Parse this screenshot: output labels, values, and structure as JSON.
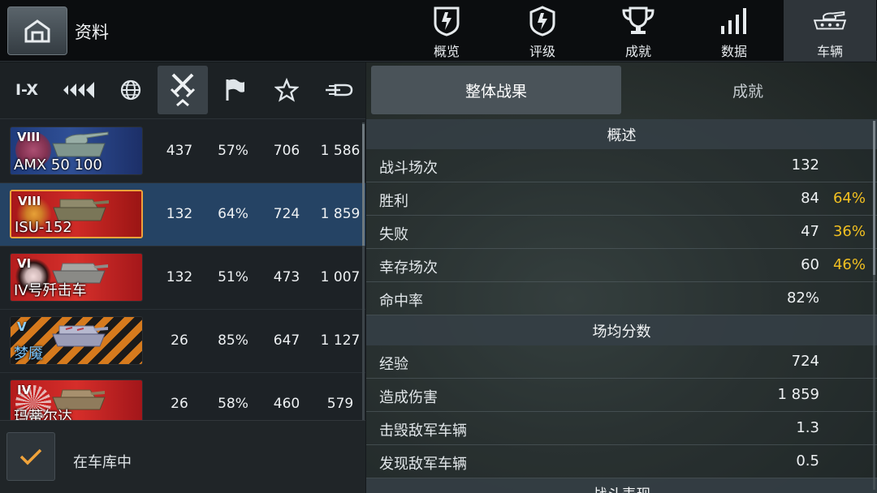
{
  "header": {
    "title": "资料",
    "tabs": [
      {
        "label": "概览",
        "icon": "shield-bolt-icon"
      },
      {
        "label": "评级",
        "icon": "rating-shield-icon"
      },
      {
        "label": "成就",
        "icon": "trophy-icon"
      },
      {
        "label": "数据",
        "icon": "bar-chart-icon"
      },
      {
        "label": "车辆",
        "icon": "tank-icon",
        "active": true
      }
    ]
  },
  "filters": {
    "tier_label": "I-X",
    "items": [
      "tier-filter",
      "vehicle-type-filter",
      "nation-filter",
      "battles-sort",
      "victories-sort",
      "favorite-filter",
      "premium-filter"
    ],
    "active": "battles-sort"
  },
  "vehicles": [
    {
      "tier": "VIII",
      "name": "AMX 50 100",
      "battles": "437",
      "winrate": "57%",
      "exp": "706",
      "damage": "1 586",
      "flag": "france",
      "premium": false
    },
    {
      "tier": "VIII",
      "name": "ISU-152",
      "battles": "132",
      "winrate": "64%",
      "exp": "724",
      "damage": "1 859",
      "flag": "ussr",
      "premium": false,
      "selected": true
    },
    {
      "tier": "VI",
      "name": "IV号歼击车",
      "battles": "132",
      "winrate": "51%",
      "exp": "473",
      "damage": "1 007",
      "flag": "germany",
      "premium": false
    },
    {
      "tier": "V",
      "name": "梦魇",
      "battles": "26",
      "winrate": "85%",
      "exp": "647",
      "damage": "1 127",
      "flag": "ribbon",
      "premium": true
    },
    {
      "tier": "IV",
      "name": "玛蒂尔达",
      "battles": "26",
      "winrate": "58%",
      "exp": "460",
      "damage": "579",
      "flag": "japan",
      "premium": false
    }
  ],
  "garage_filter": {
    "label": "在车库中",
    "checked": true
  },
  "detail_tabs": [
    {
      "label": "整体战果",
      "active": true
    },
    {
      "label": "成就",
      "active": false
    }
  ],
  "sections": [
    {
      "title": "概述",
      "rows": [
        {
          "label": "战斗场次",
          "value": "132",
          "pct": ""
        },
        {
          "label": "胜利",
          "value": "84",
          "pct": "64%"
        },
        {
          "label": "失败",
          "value": "47",
          "pct": "36%"
        },
        {
          "label": "幸存场次",
          "value": "60",
          "pct": "46%"
        },
        {
          "label": "命中率",
          "value": "82%",
          "pct": ""
        }
      ]
    },
    {
      "title": "场均分数",
      "rows": [
        {
          "label": "经验",
          "value": "724",
          "pct": ""
        },
        {
          "label": "造成伤害",
          "value": "1 859",
          "pct": ""
        },
        {
          "label": "击毁敌军车辆",
          "value": "1.3",
          "pct": ""
        },
        {
          "label": "发现敌军车辆",
          "value": "0.5",
          "pct": ""
        }
      ]
    },
    {
      "title": "战斗表现",
      "rows": []
    }
  ],
  "colors": {
    "accent": "#f0a33a",
    "percent": "#f2c021",
    "selected_row": "#254364"
  }
}
